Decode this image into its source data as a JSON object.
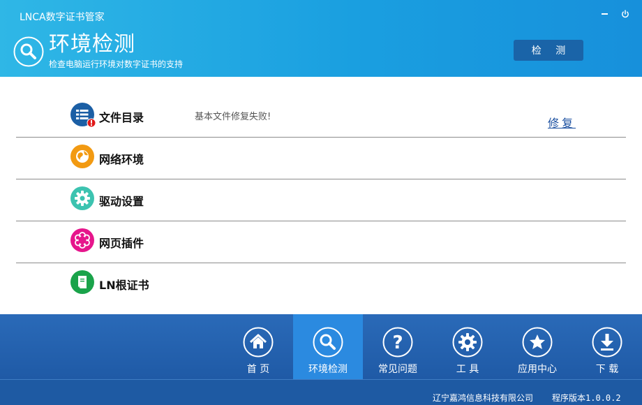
{
  "app": {
    "title": "LNCA数字证书管家"
  },
  "window": {
    "minimize_icon": "minimize-icon",
    "close_icon": "power-icon"
  },
  "hero": {
    "title": "环境检测",
    "subtitle": "检查电脑运行环境对数字证书的支持",
    "icon": "search-icon",
    "detect_button": "检 测"
  },
  "checks": [
    {
      "label": "文件目录",
      "icon": "file-list-icon",
      "status": "基本文件修复失败!",
      "action": "修复",
      "has_error": true
    },
    {
      "label": "网络环境",
      "icon": "globe-icon",
      "status": "",
      "action": "",
      "has_error": false
    },
    {
      "label": "驱动设置",
      "icon": "gear-icon",
      "status": "",
      "action": "",
      "has_error": false
    },
    {
      "label": "网页插件",
      "icon": "flower-icon",
      "status": "",
      "action": "",
      "has_error": false
    },
    {
      "label": "LN根证书",
      "icon": "certificate-icon",
      "status": "",
      "action": "",
      "has_error": false
    }
  ],
  "nav": [
    {
      "label": "首  页",
      "icon": "home-icon",
      "active": false
    },
    {
      "label": "环境检测",
      "icon": "search-icon",
      "active": true
    },
    {
      "label": "常见问题",
      "icon": "question-icon",
      "active": false
    },
    {
      "label": "工  具",
      "icon": "gear-icon",
      "active": false
    },
    {
      "label": "应用中心",
      "icon": "star-icon",
      "active": false
    },
    {
      "label": "下  载",
      "icon": "download-icon",
      "active": false
    }
  ],
  "footer": {
    "company": "辽宁嘉鸿信息科技有限公司",
    "version": "程序版本1.0.0.2"
  },
  "colors": {
    "header": "#1a9fe0",
    "nav": "#1f5aa6",
    "nav_active": "#2b8ae0",
    "detect_button": "#1a64a8",
    "link": "#1a4fa0"
  }
}
